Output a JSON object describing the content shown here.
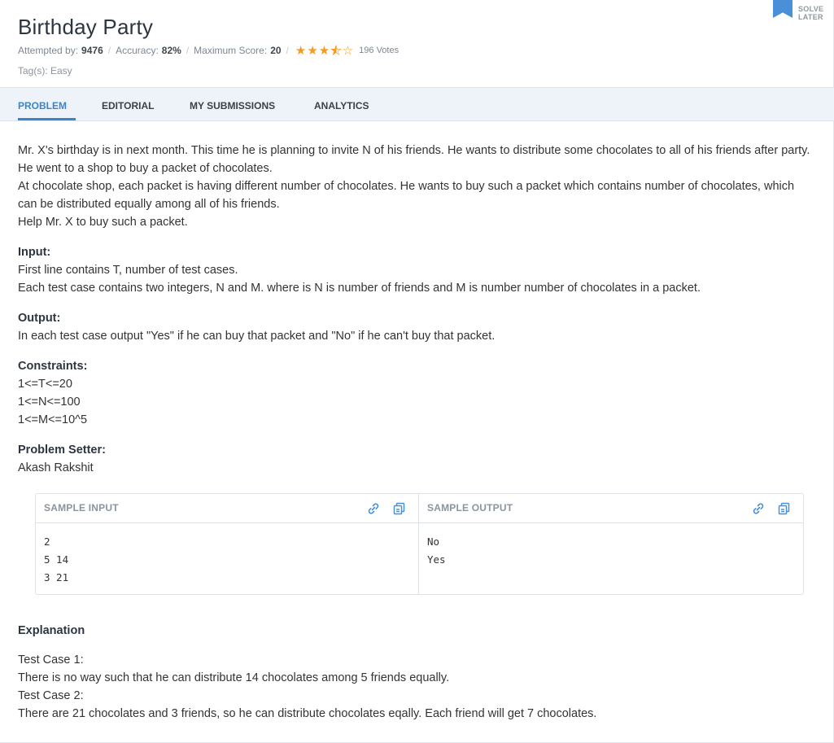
{
  "problem": {
    "title": "Birthday Party",
    "attempted_label": "Attempted by:",
    "attempted_value": "9476",
    "accuracy_label": "Accuracy:",
    "accuracy_value": "82%",
    "max_score_label": "Maximum Score:",
    "max_score_value": "20",
    "rating": 3.5,
    "votes": "196 Votes",
    "tags": "Tag(s): Easy",
    "solve_later_line1": "SOLVE",
    "solve_later_line2": "LATER"
  },
  "tabs": [
    {
      "label": "PROBLEM",
      "active": true
    },
    {
      "label": "EDITORIAL",
      "active": false
    },
    {
      "label": "MY SUBMISSIONS",
      "active": false
    },
    {
      "label": "ANALYTICS",
      "active": false
    }
  ],
  "statement": {
    "intro": [
      "Mr. X's birthday is in next month. This time he is planning to invite N of his friends. He wants to distribute some chocolates to all of his friends after party. He went to a shop to buy a packet of chocolates.",
      "At chocolate shop, each packet is having different number of chocolates. He wants to buy such a packet which contains number of chocolates, which can be distributed equally among all of his friends.",
      "Help Mr. X to buy such a packet."
    ],
    "input_label": "Input:",
    "input_lines": [
      "First line contains T, number of test cases.",
      "Each test case contains two integers, N and M. where is N is number of friends and M is number number of chocolates in a packet."
    ],
    "output_label": "Output:",
    "output_lines": [
      "In each test case output \"Yes\" if he can buy that packet and \"No\" if he can't buy that packet."
    ],
    "constraints_label": "Constraints:",
    "constraints_lines": [
      "1<=T<=20",
      "1<=N<=100",
      "1<=M<=10^5"
    ],
    "setter_label": "Problem Setter:",
    "setter_name": "Akash Rakshit"
  },
  "sample": {
    "input_title": "SAMPLE INPUT",
    "input_text": "2\n5 14\n3 21",
    "output_title": "SAMPLE OUTPUT",
    "output_text": "No\nYes"
  },
  "explanation": {
    "label": "Explanation",
    "lines": [
      "Test Case 1:",
      "There is no way such that he can distribute 14 chocolates among 5 friends equally.",
      "Test Case 2:",
      "There are 21 chocolates and 3 friends, so he can distribute chocolates eqally. Each friend will get 7 chocolates."
    ]
  },
  "colors": {
    "accent": "#3d84c6",
    "star": "#f59a23",
    "tab_bar": "#eef3f9"
  },
  "icons": {
    "bookmark": "bookmark-icon",
    "link": "link-icon",
    "copy": "copy-icon",
    "star": "star-icon"
  }
}
